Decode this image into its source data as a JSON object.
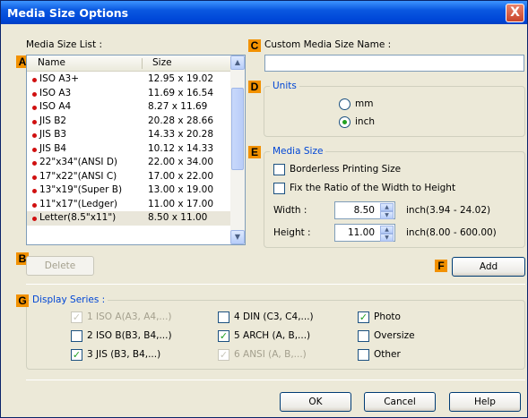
{
  "window": {
    "title": "Media Size Options",
    "close_glyph": "X"
  },
  "callouts": {
    "a": "A",
    "b": "B",
    "c": "C",
    "d": "D",
    "e": "E",
    "f": "F",
    "g": "G"
  },
  "media_list": {
    "label": "Media Size List :",
    "columns": {
      "name": "Name",
      "size": "Size"
    },
    "rows": [
      {
        "name": "ISO A3+",
        "size": "12.95 x 19.02"
      },
      {
        "name": "ISO A3",
        "size": "11.69 x 16.54"
      },
      {
        "name": "ISO A4",
        "size": "8.27 x 11.69"
      },
      {
        "name": "JIS B2",
        "size": "20.28 x 28.66"
      },
      {
        "name": "JIS B3",
        "size": "14.33 x 20.28"
      },
      {
        "name": "JIS B4",
        "size": "10.12 x 14.33"
      },
      {
        "name": "22\"x34\"(ANSI D)",
        "size": "22.00 x 34.00"
      },
      {
        "name": "17\"x22\"(ANSI C)",
        "size": "17.00 x 22.00"
      },
      {
        "name": "13\"x19\"(Super B)",
        "size": "13.00 x 19.00"
      },
      {
        "name": "11\"x17\"(Ledger)",
        "size": "11.00 x 17.00"
      },
      {
        "name": "Letter(8.5\"x11\")",
        "size": "8.50 x 11.00"
      }
    ],
    "delete_label": "Delete"
  },
  "custom_name": {
    "label": "Custom Media Size Name :",
    "value": ""
  },
  "units": {
    "title": "Units",
    "options": [
      {
        "label": "mm",
        "selected": false
      },
      {
        "label": "inch",
        "selected": true
      }
    ]
  },
  "media_size": {
    "title": "Media Size",
    "borderless_label": "Borderless Printing Size",
    "fix_ratio_label": "Fix the Ratio of the Width to Height",
    "width": {
      "label": "Width :",
      "value": "8.50",
      "range": "inch(3.94 - 24.02)"
    },
    "height": {
      "label": "Height :",
      "value": "11.00",
      "range": "inch(8.00 - 600.00)"
    }
  },
  "add_label": "Add",
  "display_series": {
    "title": "Display Series :",
    "items": [
      {
        "label": "1 ISO A(A3, A4,...)",
        "checked": true,
        "enabled": false
      },
      {
        "label": "2 ISO B(B3, B4,...)",
        "checked": false,
        "enabled": true
      },
      {
        "label": "3 JIS (B3, B4,...)",
        "checked": true,
        "enabled": true
      },
      {
        "label": "4 DIN (C3, C4,...)",
        "checked": false,
        "enabled": true
      },
      {
        "label": "5 ARCH (A, B,...)",
        "checked": true,
        "enabled": true
      },
      {
        "label": "6 ANSI (A, B,...)",
        "checked": true,
        "enabled": false
      },
      {
        "label": "Photo",
        "checked": true,
        "enabled": true
      },
      {
        "label": "Oversize",
        "checked": false,
        "enabled": true
      },
      {
        "label": "Other",
        "checked": false,
        "enabled": true
      }
    ]
  },
  "footer": {
    "ok": "OK",
    "cancel": "Cancel",
    "help": "Help"
  },
  "icons": {
    "check": "✓",
    "up": "▲",
    "down": "▼"
  },
  "colors": {
    "title_bar": "#0a58e0",
    "callout": "#f29100",
    "group_title": "#0046d5"
  }
}
